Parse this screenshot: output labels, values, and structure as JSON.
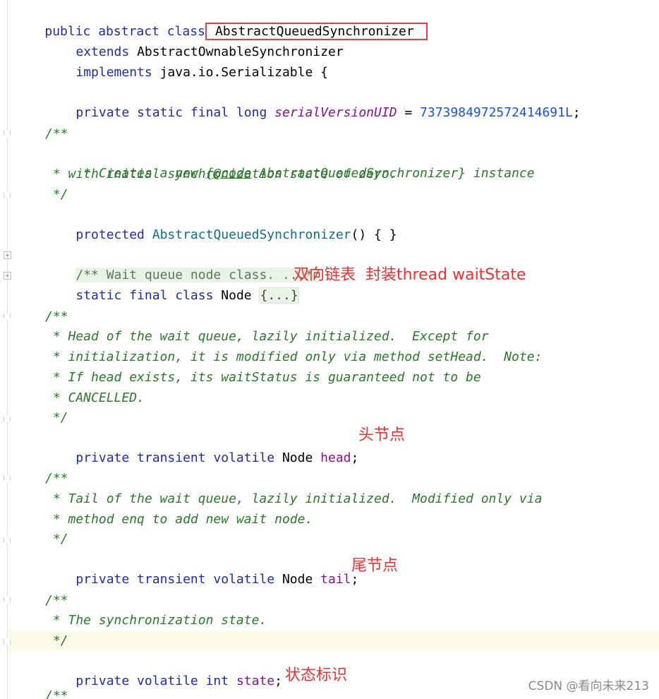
{
  "code": {
    "class_decl": {
      "modifiers": "public abstract class",
      "name": "AbstractQueuedSynchronizer"
    },
    "extends_kw": "extends",
    "extends_name": "AbstractOwnableSynchronizer",
    "implements_kw": "implements",
    "implements_name": "java.io.Serializable {",
    "serial": {
      "modifiers": "private static final long",
      "field": "serialVersionUID",
      "eq": " = ",
      "value": "7373984972572414691L",
      "end": ";"
    },
    "ctor_doc": {
      "open": "/**",
      "line1_pre": " * Creates a new ",
      "line1_tag": "{@code",
      "line1_post": " AbstractQueuedSynchronizer} instance",
      "line2": " * with initial synchronization state of zero.",
      "close": " */"
    },
    "ctor": {
      "modifier": "protected",
      "name": "AbstractQueuedSynchronizer",
      "rest": "() { }"
    },
    "node_doc_folded": "/** Wait queue node class. ...*/",
    "node_class": {
      "modifiers": "static final class",
      "name": "Node",
      "body": "{...}"
    },
    "head_doc": {
      "open": "/**",
      "line1": " * Head of the wait queue, lazily initialized.  Except for",
      "line2": " * initialization, it is modified only via method setHead.  Note:",
      "line3": " * If head exists, its waitStatus is guaranteed not to be",
      "line4": " * CANCELLED.",
      "close": " */"
    },
    "head_field": {
      "modifiers": "private transient volatile",
      "type": "Node",
      "name": "head",
      "end": ";"
    },
    "tail_doc": {
      "open": "/**",
      "line1": " * Tail of the wait queue, lazily initialized.  Modified only via",
      "line2": " * method enq to add new wait node.",
      "close": " */"
    },
    "tail_field": {
      "modifiers": "private transient volatile",
      "type": "Node",
      "name": "tail",
      "end": ";"
    },
    "state_doc": {
      "open": "/**",
      "line1": " * The synchronization state.",
      "close": " */"
    },
    "state_field": {
      "modifiers": "private volatile",
      "type": "int",
      "name": "state",
      "end": ";"
    },
    "next_doc_open": "/**"
  },
  "annotations": {
    "node": "双向链表  封装thread waitState",
    "head": "头节点",
    "tail": "尾节点",
    "state": "状态标识"
  },
  "watermark": "CSDN @看向未来213",
  "colors": {
    "keyword": "#1f2ba8",
    "field": "#871094",
    "number": "#1750eb",
    "doc_comment": "#2a7a2a",
    "annotation": "#f03030",
    "highlight_box": "#e04040"
  }
}
